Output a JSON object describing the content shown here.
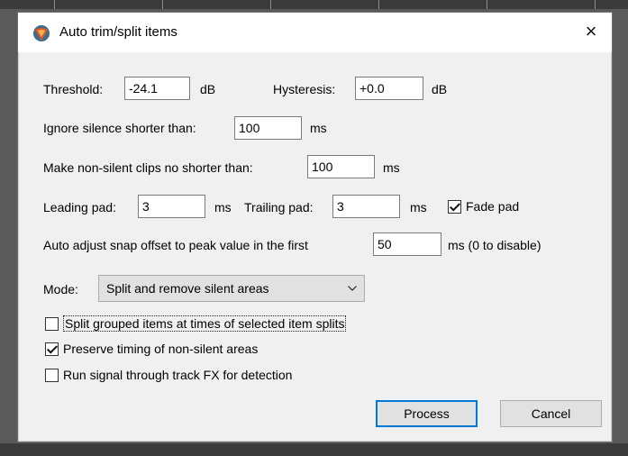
{
  "dialog": {
    "title": "Auto trim/split items",
    "close_glyph": "×",
    "icon": "reaper-logo-icon"
  },
  "threshold": {
    "label": "Threshold:",
    "value": "-24.1",
    "unit": "dB"
  },
  "hysteresis": {
    "label": "Hysteresis:",
    "value": "+0.0",
    "unit": "dB"
  },
  "ignore_silence": {
    "label": "Ignore silence shorter than:",
    "value": "100",
    "unit": "ms"
  },
  "min_clip": {
    "label": "Make non-silent clips no shorter than:",
    "value": "100",
    "unit": "ms"
  },
  "leading_pad": {
    "label": "Leading pad:",
    "value": "3",
    "unit": "ms"
  },
  "trailing_pad": {
    "label": "Trailing pad:",
    "value": "3",
    "unit": "ms"
  },
  "fade_pad": {
    "label": "Fade pad",
    "checked": true
  },
  "snap_offset": {
    "label": "Auto adjust snap offset to peak value in the first",
    "value": "50",
    "unit": "ms (0 to disable)"
  },
  "mode": {
    "label": "Mode:",
    "selected": "Split and remove silent areas"
  },
  "options": [
    {
      "label": "Split grouped items at times of selected item splits",
      "checked": false
    },
    {
      "label": "Preserve timing of non-silent areas",
      "checked": true
    },
    {
      "label": "Run signal through track FX for detection",
      "checked": false
    }
  ],
  "buttons": {
    "process": "Process",
    "cancel": "Cancel"
  }
}
